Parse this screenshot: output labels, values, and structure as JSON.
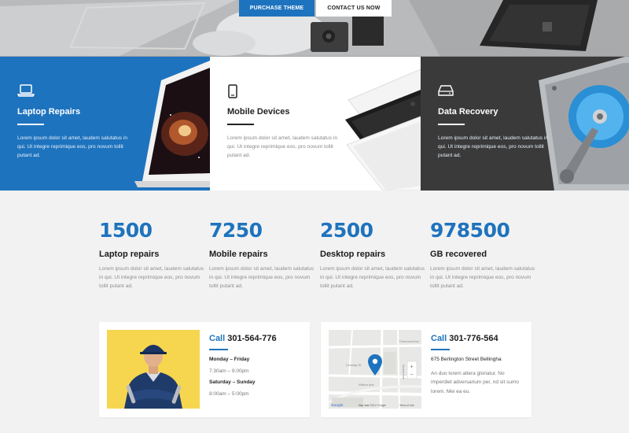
{
  "hero": {
    "purchase_label": "PURCHASE THEME",
    "contact_label": "CONTACT US NOW"
  },
  "services": [
    {
      "title": "Laptop Repairs",
      "text": "Lorem ipsum dolor sit amet, laudem salutatus in qui. Ut integre reprimique eos, pro novum tollit putant ad.",
      "icon": "laptop-icon"
    },
    {
      "title": "Mobile Devices",
      "text": "Lorem ipsum dolor sit amet, laudem salutatus in qui. Ut integre reprimique eos, pro novum tollit putant ad.",
      "icon": "mobile-icon"
    },
    {
      "title": "Data Recovery",
      "text": "Lorem ipsum dolor sit amet, laudem salutatus in qui. Ut integre reprimique eos, pro novum tollit putant ad.",
      "icon": "hard-drive-icon"
    }
  ],
  "stats": [
    {
      "number": "1500",
      "label": "Laptop repairs",
      "text": "Lorem ipsum dolor sit amet, laudem salutatus in qui. Ut integre reprimique eos, pro novum tollit putant ad."
    },
    {
      "number": "7250",
      "label": "Mobile repairs",
      "text": "Lorem ipsum dolor sit amet, laudem salutatus in qui. Ut integre reprimique eos, pro novum tollit putant ad."
    },
    {
      "number": "2500",
      "label": "Desktop repairs",
      "text": "Lorem ipsum dolor sit amet, laudem salutatus in qui. Ut integre reprimique eos, pro novum tollit putant ad."
    },
    {
      "number": "978500",
      "label": "GB recovered",
      "text": "Lorem ipsum dolor sit amet, laudem salutatus in qui. Ut integre reprimique eos, pro novum tollit putant ad."
    }
  ],
  "contact_hours": {
    "call_word": "Call",
    "phone": "301-564-776",
    "weekday_label": "Monday – Friday",
    "weekday_hours": "7:30am – 9:00pm",
    "weekend_label": "Saturday – Sunday",
    "weekend_hours": "8:00am – 5:00pm"
  },
  "contact_location": {
    "call_word": "Call",
    "phone": "301-776-564",
    "address": "675 Berlington Street Bellingha",
    "text": "An duo lorem altera gloriatur. No imperdiet adversarium per, nd sit sumo lorem. Mei ea eu.",
    "map_labels": {
      "street_1": "Freemont Ave",
      "street_2": "Conway St",
      "street_3": "Wilson Ave",
      "street_4": "Grand Ave",
      "map_credit": "Map data ©2017 Google",
      "terms": "Terms of Use",
      "google": "Google",
      "zoom_in": "+",
      "zoom_out": "−"
    }
  },
  "colors": {
    "accent": "#1e73be",
    "panel_dark": "#3a3a3a",
    "technician_bg": "#f6d64f"
  }
}
